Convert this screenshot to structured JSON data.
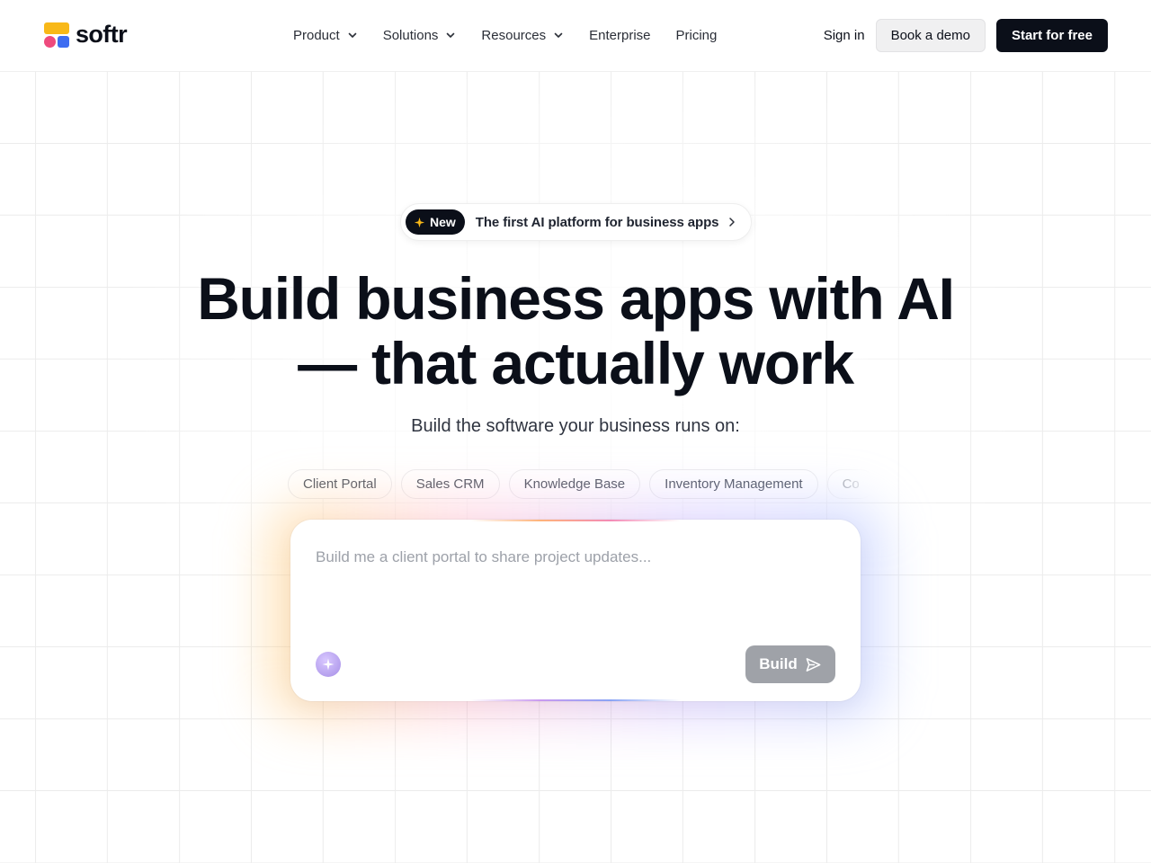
{
  "brand": {
    "name": "softr",
    "colors": {
      "yellow": "#f8b818",
      "pink": "#ee4a7d",
      "blue": "#3d6cf1",
      "dark": "#0b0f19"
    }
  },
  "nav": {
    "items": [
      {
        "label": "Product",
        "has_dropdown": true
      },
      {
        "label": "Solutions",
        "has_dropdown": true
      },
      {
        "label": "Resources",
        "has_dropdown": true
      },
      {
        "label": "Enterprise",
        "has_dropdown": false
      },
      {
        "label": "Pricing",
        "has_dropdown": false
      }
    ]
  },
  "header_actions": {
    "sign_in": "Sign in",
    "book_demo": "Book a demo",
    "start_free": "Start for free"
  },
  "hero": {
    "badge": "New",
    "badge_icon": "sparkle-icon",
    "announcement": "The first AI platform for business apps",
    "title_line1": "Build business apps with AI",
    "title_line2": "— that actually work",
    "subtitle": "Build the software your business runs on:",
    "chips": [
      "Client Portal",
      "Sales CRM",
      "Knowledge Base",
      "Inventory Management",
      "Co"
    ]
  },
  "prompt": {
    "placeholder": "Build me a client portal to share project updates...",
    "value": "",
    "build_label": "Build",
    "ai_icon": "ai-sparkle-icon",
    "send_icon": "send-icon"
  }
}
